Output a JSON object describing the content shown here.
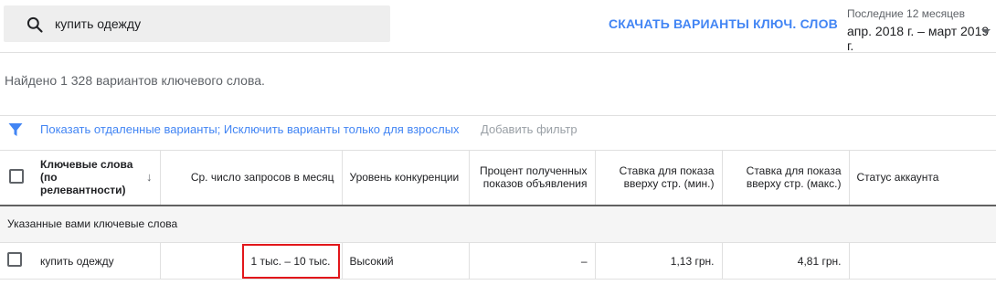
{
  "search": {
    "value": "купить одежду"
  },
  "header": {
    "download_label": "СКАЧАТЬ ВАРИАНТЫ КЛЮЧ. СЛОВ",
    "period_label": "Последние 12 месяцев",
    "period_value": "апр. 2018 г. – март 2019 г."
  },
  "found_text": "Найдено 1 328 вариантов ключевого слова.",
  "filters": {
    "link_text": "Показать отдаленные варианты; Исключить варианты только для взрослых",
    "add_filter": "Добавить фильтр"
  },
  "table": {
    "columns": [
      "Ключевые слова (по релевантности)",
      "Ср. число запросов в месяц",
      "Уровень конкуренции",
      "Процент полученных показов объявления",
      "Ставка для показа вверху стр. (мин.)",
      "Ставка для показа вверху стр. (макс.)",
      "Статус аккаунта"
    ],
    "group_label": "Указанные вами ключевые слова",
    "rows": [
      {
        "keyword": "купить одежду",
        "searches": "1 тыс. – 10 тыс.",
        "competition": "Высокий",
        "impression_share": "–",
        "bid_low": "1,13 грн.",
        "bid_high": "4,81 грн.",
        "status": ""
      }
    ]
  },
  "colors": {
    "accent": "#4285f4",
    "highlight": "#e2171b"
  }
}
